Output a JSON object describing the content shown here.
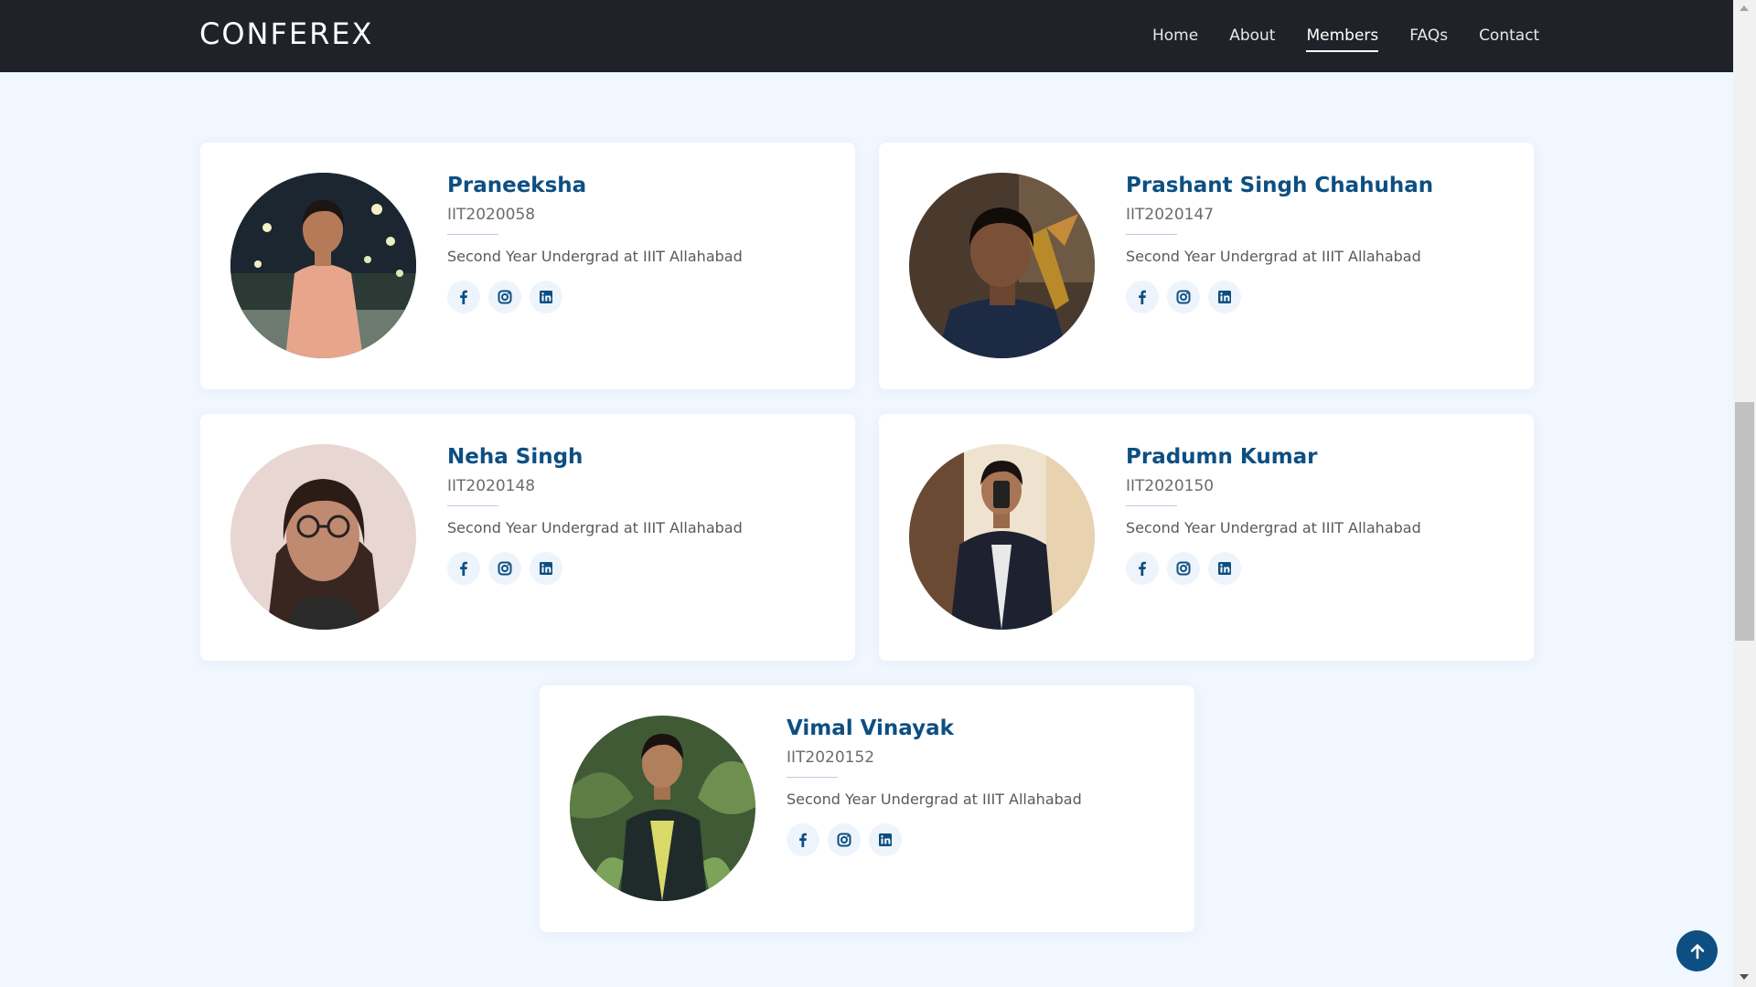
{
  "header": {
    "brand": "CONFEREX",
    "nav": [
      {
        "label": "Home",
        "active": false
      },
      {
        "label": "About",
        "active": false
      },
      {
        "label": "Members",
        "active": true
      },
      {
        "label": "FAQs",
        "active": false
      },
      {
        "label": "Contact",
        "active": false
      }
    ]
  },
  "members": [
    {
      "name": "Praneeksha",
      "roll": "IIT2020058",
      "description": "Second Year Undergrad at IIIT Allahabad"
    },
    {
      "name": "Prashant Singh Chahuhan",
      "roll": "IIT2020147",
      "description": "Second Year Undergrad at IIIT Allahabad"
    },
    {
      "name": "Neha Singh",
      "roll": "IIT2020148",
      "description": "Second Year Undergrad at IIIT Allahabad"
    },
    {
      "name": "Pradumn Kumar",
      "roll": "IIT2020150",
      "description": "Second Year Undergrad at IIIT Allahabad"
    },
    {
      "name": "Vimal Vinayak",
      "roll": "IIT2020152",
      "description": "Second Year Undergrad at IIIT Allahabad"
    }
  ],
  "icons": {
    "social": [
      "facebook-icon",
      "instagram-icon",
      "linkedin-icon"
    ],
    "back_to_top": "arrow-up-icon"
  },
  "colors": {
    "header_bg": "#1f2329",
    "page_bg": "#f1f7ff",
    "accent": "#0d4f82",
    "icon_bg": "#eef4fb"
  }
}
